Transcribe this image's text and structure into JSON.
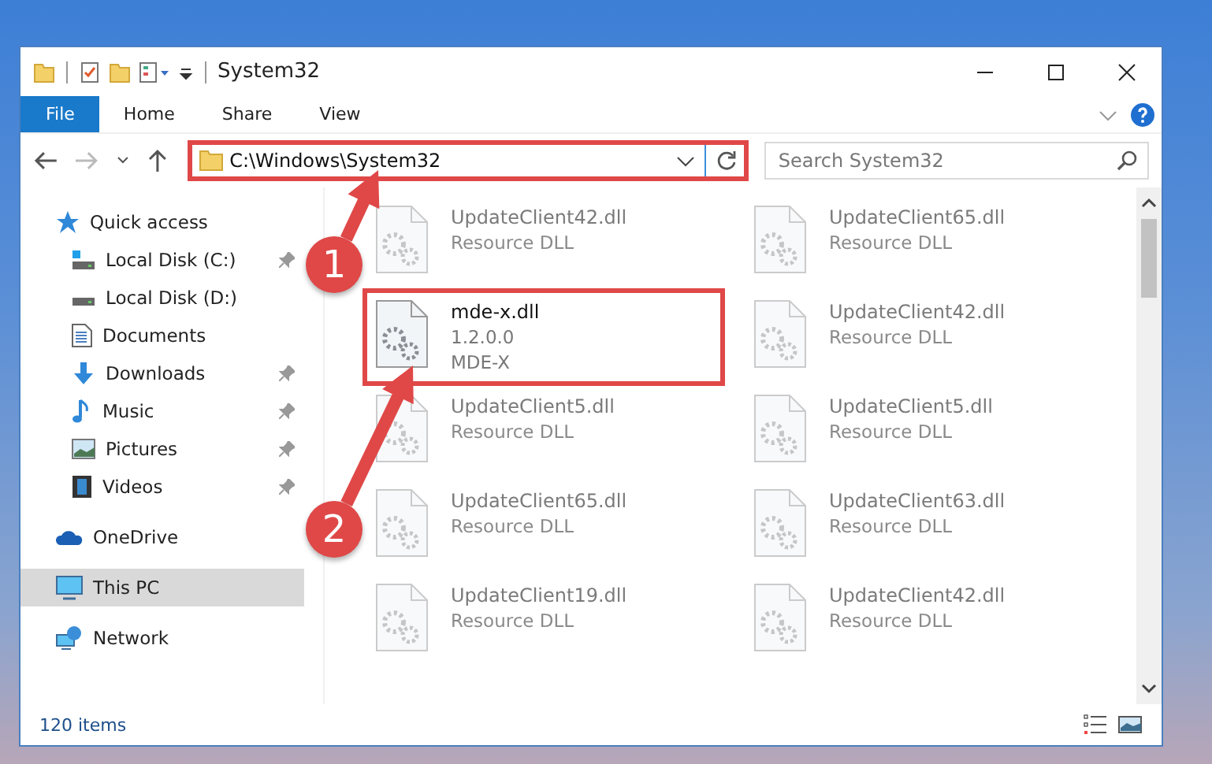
{
  "window": {
    "title": "System32"
  },
  "ribbon": {
    "tabs": [
      {
        "label": "File",
        "selected": true
      },
      {
        "label": "Home",
        "selected": false
      },
      {
        "label": "Share",
        "selected": false
      },
      {
        "label": "View",
        "selected": false
      }
    ]
  },
  "address_bar": {
    "path": "C:\\Windows\\System32",
    "highlighted": true
  },
  "search": {
    "placeholder": "Search System32"
  },
  "sidebar": {
    "items": [
      {
        "label": "Quick access",
        "kind": "star",
        "selected": false,
        "children": [
          {
            "label": "Local Disk (C:)",
            "kind": "drive-c",
            "pinned": true,
            "selected": false
          },
          {
            "label": "Local Disk (D:)",
            "kind": "drive",
            "pinned": false,
            "selected": false
          },
          {
            "label": "Documents",
            "kind": "documents",
            "pinned": false,
            "selected": false
          },
          {
            "label": "Downloads",
            "kind": "downloads",
            "pinned": true,
            "selected": false
          },
          {
            "label": "Music",
            "kind": "music",
            "pinned": true,
            "selected": false
          },
          {
            "label": "Pictures",
            "kind": "pictures",
            "pinned": true,
            "selected": false
          },
          {
            "label": "Videos",
            "kind": "videos",
            "pinned": true,
            "selected": false
          }
        ]
      },
      {
        "label": "OneDrive",
        "kind": "cloud",
        "selected": false
      },
      {
        "label": "This PC",
        "kind": "computer",
        "selected": true
      },
      {
        "label": "Network",
        "kind": "network",
        "selected": false
      }
    ]
  },
  "files": [
    {
      "name": "UpdateClient42.dll",
      "line_2": "Resource DLL",
      "blurred": true,
      "highlighted": false
    },
    {
      "name": "UpdateClient65.dll",
      "line_2": "Resource DLL",
      "blurred": true,
      "highlighted": false
    },
    {
      "name": "mde-x.dll",
      "line_2": "1.2.0.0",
      "line_3": "MDE-X",
      "blurred": false,
      "highlighted": true
    },
    {
      "name": "UpdateClient42.dll",
      "line_2": "Resource DLL",
      "blurred": true,
      "highlighted": false
    },
    {
      "name": "UpdateClient5.dll",
      "line_2": "Resource DLL",
      "blurred": true,
      "highlighted": false
    },
    {
      "name": "UpdateClient5.dll",
      "line_2": "Resource DLL",
      "blurred": true,
      "highlighted": false
    },
    {
      "name": "UpdateClient65.dll",
      "line_2": "Resource DLL",
      "blurred": true,
      "highlighted": false
    },
    {
      "name": "UpdateClient63.dll",
      "line_2": "Resource DLL",
      "blurred": true,
      "highlighted": false
    },
    {
      "name": "UpdateClient19.dll",
      "line_2": "Resource DLL",
      "blurred": true,
      "highlighted": false
    },
    {
      "name": "UpdateClient42.dll",
      "line_2": "Resource DLL",
      "blurred": true,
      "highlighted": false
    }
  ],
  "status_bar": {
    "item_count": "120 items"
  },
  "annotations": [
    {
      "number": "1"
    },
    {
      "number": "2"
    }
  ]
}
